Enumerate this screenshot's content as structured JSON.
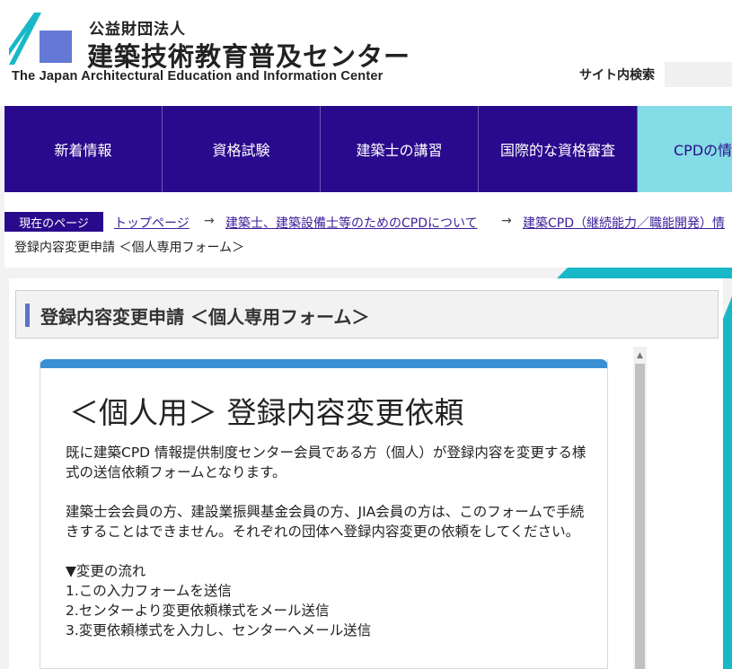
{
  "header": {
    "org_type": "公益財団法人",
    "org_name": "建築技術教育普及センター",
    "org_name_en": "The Japan Architectural Education and Information Center",
    "search_label": "サイト内検索",
    "search_value": ""
  },
  "nav": {
    "items": [
      {
        "label": "新着情報"
      },
      {
        "label": "資格試験"
      },
      {
        "label": "建築士の講習"
      },
      {
        "label": "国際的な資格審査"
      },
      {
        "label": "CPDの情"
      }
    ]
  },
  "breadcrumb": {
    "current_label": "現在のページ",
    "links": [
      "トップページ",
      "建築士、建築設備士等のためのCPDについて",
      "建築CPD（継続能力／職能開発）情"
    ],
    "arrow": "→",
    "last": "登録内容変更申請 ＜個人専用フォーム＞"
  },
  "page": {
    "title": "登録内容変更申請 ＜個人専用フォーム＞"
  },
  "form": {
    "heading": "＜個人用＞ 登録内容変更依頼",
    "para1": "既に建築CPD 情報提供制度センター会員である方（個人）が登録内容を変更する様式の送信依頼フォームとなります。",
    "para2": "建築士会会員の方、建設業振興基金会員の方、JIA会員の方は、このフォームで手続きすることはできません。それぞれの団体へ登録内容変更の依頼をしてください。",
    "flow_title": "▼変更の流れ",
    "flow_steps": [
      "1.この入力フォームを送信",
      "2.センターより変更依頼様式をメール送信",
      "3.変更依頼様式を入力し、センターへメール送信"
    ]
  },
  "colors": {
    "brand_purple": "#2a0a8c",
    "accent_teal": "#18b8c8",
    "active_tab": "#84dde6",
    "card_top": "#3a8fd2"
  },
  "icons": {
    "scroll_up": "▲"
  }
}
